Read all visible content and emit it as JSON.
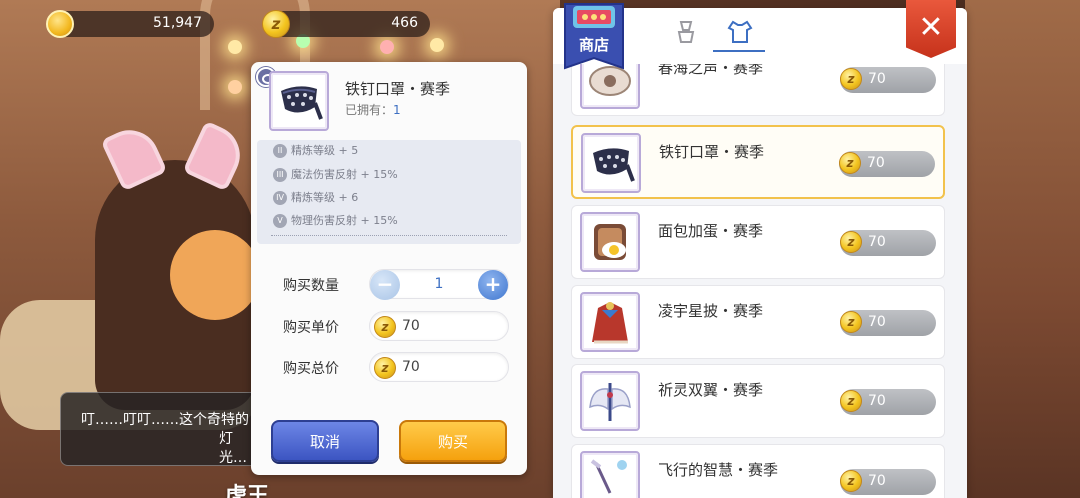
{
  "currency": {
    "gold": "51,947",
    "zeny": "466"
  },
  "dialog": {
    "text_line1": "叮……叮叮……这个奇特的",
    "text_line2": "灯光…",
    "speaker": "虎王"
  },
  "popup": {
    "item_name": "铁钉口罩・赛季",
    "owned_label": "已拥有：",
    "owned_count": "1",
    "attributes": [
      {
        "roman": "II",
        "text": "精炼等级 + 5"
      },
      {
        "roman": "III",
        "text": "魔法伤害反射 + 15%"
      },
      {
        "roman": "IV",
        "text": "精炼等级 + 6"
      },
      {
        "roman": "V",
        "text": "物理伤害反射 + 15%"
      }
    ],
    "quantity_label": "购买数量",
    "quantity": "1",
    "unit_price_label": "购买单价",
    "unit_price": "70",
    "total_price_label": "购买总价",
    "total_price": "70",
    "cancel_label": "取消",
    "buy_label": "购买"
  },
  "shop": {
    "badge_label": "商店",
    "close_icon": "✕",
    "items": [
      {
        "name": "春海之声・赛季",
        "price": "70"
      },
      {
        "name": "铁钉口罩・赛季",
        "price": "70",
        "selected": true
      },
      {
        "name": "面包加蛋・赛季",
        "price": "70"
      },
      {
        "name": "凌宇星披・赛季",
        "price": "70"
      },
      {
        "name": "祈灵双翼・赛季",
        "price": "70"
      },
      {
        "name": "飞行的智慧・赛季",
        "price": "70"
      }
    ]
  },
  "colors": {
    "accent_blue": "#3d6fc2",
    "selected_border": "#f2c24c",
    "buy_orange": "#f5a10e",
    "cancel_blue": "#3c55c2",
    "close_red": "#d6402a"
  }
}
